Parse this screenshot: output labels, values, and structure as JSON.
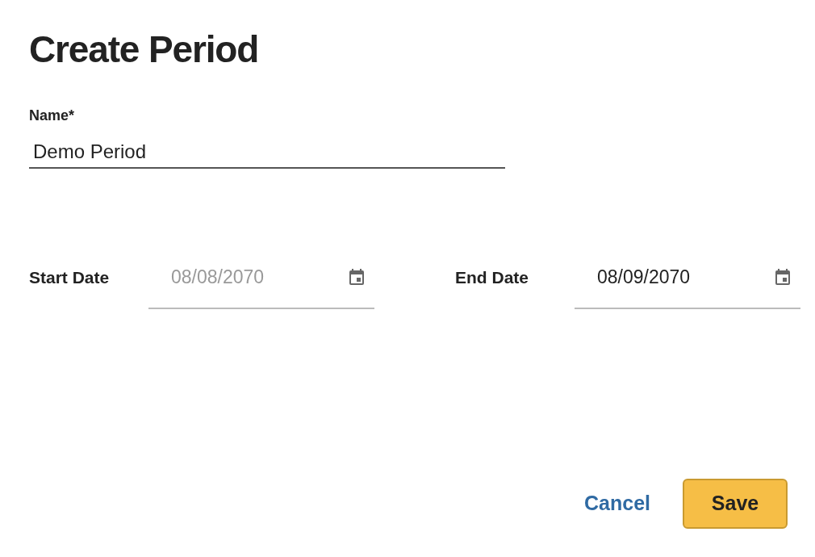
{
  "title": "Create Period",
  "name_field": {
    "label": "Name*",
    "value": "Demo Period"
  },
  "date_fields": [
    {
      "label": "Start Date",
      "placeholder": "08/08/2070"
    },
    {
      "label": "End Date",
      "value": "08/09/2070"
    }
  ],
  "buttons": [
    {
      "kind": "link",
      "label": "Cancel"
    },
    {
      "kind": "primary",
      "label": "Save"
    }
  ]
}
